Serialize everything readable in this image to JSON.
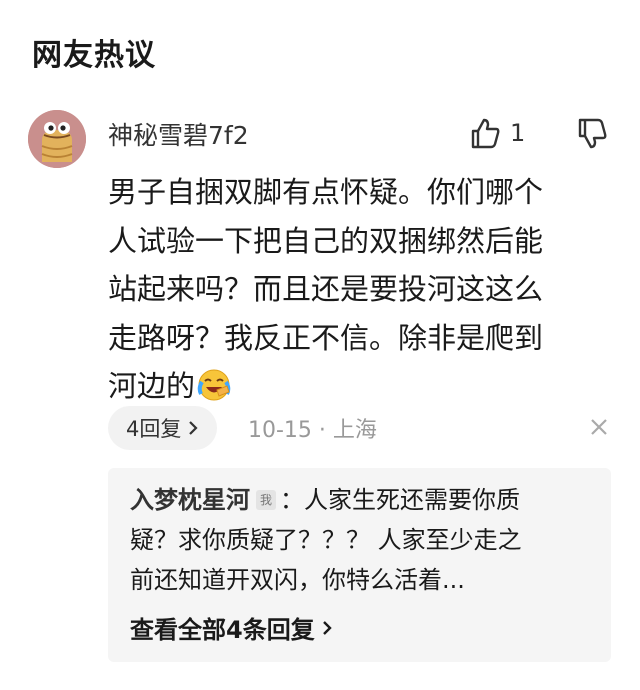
{
  "section": {
    "title": "网友热议"
  },
  "comment": {
    "username": "神秘雪碧7f2",
    "likes": "1",
    "lines": [
      "男子自捆双脚有点怀疑。你们哪个",
      "人试验一下把自己的双捆绑然后能",
      "站起来吗？而且还是要投河这这么",
      "走路呀？我反正不信。除非是爬到",
      "河边的"
    ],
    "emoji": "laughing-crying-emoji",
    "reply_label": "4回复",
    "date": "10-15",
    "separator": " · ",
    "location": "上海"
  },
  "sub_reply": {
    "author": "入梦枕星河",
    "badge": "我",
    "colon": "：",
    "text_line1": "人家生死还需要你质",
    "text_line2": "疑？求你质疑了？？？ 人家至少走之",
    "text_line3": "前还知道开双闪，你特么活着...",
    "view_all": "查看全部4条回复"
  },
  "colors": {
    "background": "#ffffff",
    "panel": "#f5f5f5",
    "meta": "#999999",
    "avatar": "#c98f8d"
  }
}
